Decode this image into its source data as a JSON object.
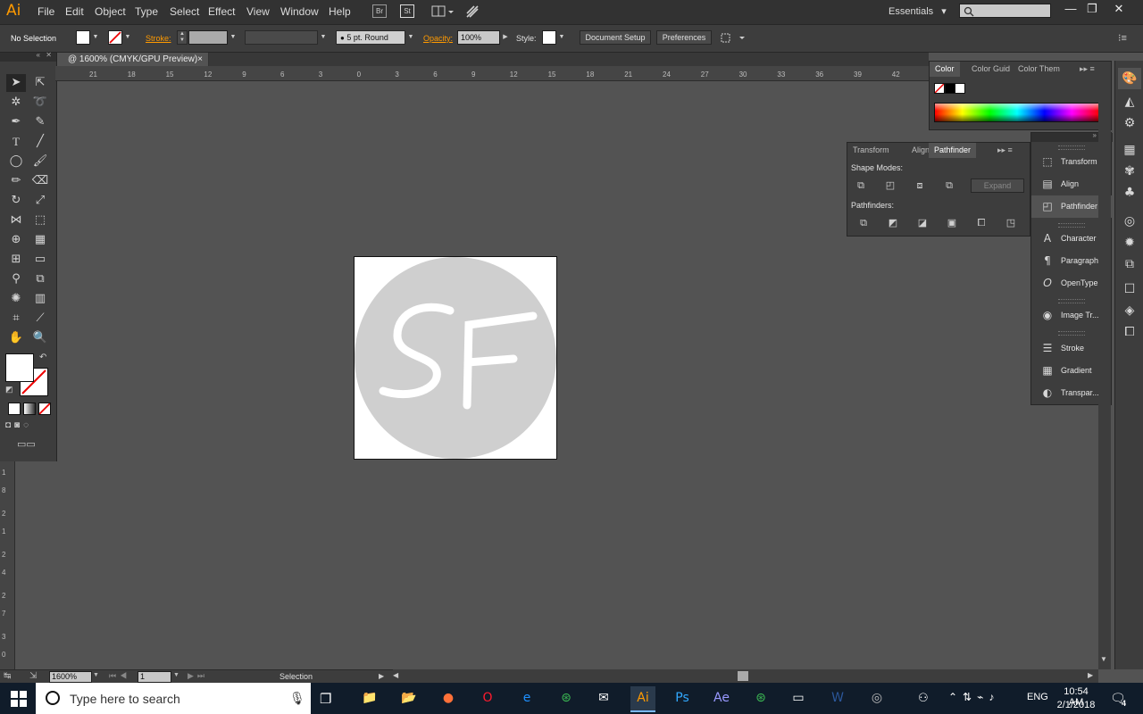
{
  "app": {
    "logo": "Ai"
  },
  "menu": [
    "File",
    "Edit",
    "Object",
    "Type",
    "Select",
    "Effect",
    "View",
    "Window",
    "Help"
  ],
  "menubar_buttons": {
    "bridge": "Br",
    "stock": "St"
  },
  "workspace": {
    "label": "Essentials",
    "arrow": "▾"
  },
  "window_controls": {
    "minimize": "—",
    "restore": "❐",
    "close": "✕"
  },
  "control": {
    "selection": "No Selection",
    "stroke_label": "Stroke:",
    "brush": "5 pt. Round",
    "opacity_label": "Opacity:",
    "opacity_value": "100%",
    "style_label": "Style:",
    "document_setup": "Document Setup",
    "preferences": "Preferences"
  },
  "document_tab": {
    "title": "@ 1600% (CMYK/GPU Preview)",
    "close": "×"
  },
  "ruler_h": [
    "21",
    "18",
    "15",
    "12",
    "9",
    "6",
    "3",
    "0",
    "3",
    "6",
    "9",
    "12",
    "15",
    "18",
    "21",
    "24",
    "27",
    "30",
    "33",
    "36",
    "39",
    "42"
  ],
  "ruler_v": [
    "1",
    "8",
    "2",
    "1",
    "2",
    "4",
    "2",
    "7",
    "3",
    "0"
  ],
  "artwork": {
    "text": "SF",
    "circle_color": "#cfcfcf"
  },
  "color_panel": {
    "tabs": [
      "Color",
      "Color Guid",
      "Color Them"
    ]
  },
  "pathfinder_panel": {
    "tabs": [
      "Transform",
      "Align",
      "Pathfinder"
    ],
    "shape_modes_label": "Shape Modes:",
    "pathfinders_label": "Pathfinders:",
    "expand": "Expand"
  },
  "dock": {
    "group1": [
      "Transform",
      "Align",
      "Pathfinder"
    ],
    "group2": [
      "Character",
      "Paragraph",
      "OpenType"
    ],
    "group3": [
      "Image Tr..."
    ],
    "group4": [
      "Stroke",
      "Gradient",
      "Transpar..."
    ]
  },
  "status": {
    "zoom": "1600%",
    "artboard": "1",
    "tool": "Selection"
  },
  "taskbar": {
    "search_placeholder": "Type here to search",
    "lang": "ENG",
    "time": "10:54 AM",
    "date": "2/1/2018",
    "notif_count": "4",
    "apps": [
      {
        "icon": "file-explorer-icon",
        "label": "📁",
        "color": "#f0c040"
      },
      {
        "icon": "folder-icon",
        "label": "📂",
        "color": "#3e8ed8"
      },
      {
        "icon": "firefox-icon",
        "label": "●",
        "color": "#ff7139"
      },
      {
        "icon": "opera-icon",
        "label": "O",
        "color": "#ff1b2d"
      },
      {
        "icon": "edge-icon",
        "label": "e",
        "color": "#1e90ff"
      },
      {
        "icon": "chrome-like-icon",
        "label": "⊛",
        "color": "#3cba54"
      },
      {
        "icon": "mail-icon",
        "label": "✉",
        "color": "#ffffff"
      },
      {
        "icon": "illustrator-icon",
        "label": "Ai",
        "color": "#ff9a00"
      },
      {
        "icon": "photoshop-icon",
        "label": "Ps",
        "color": "#31a8ff"
      },
      {
        "icon": "after-effects-icon",
        "label": "Ae",
        "color": "#9999ff"
      },
      {
        "icon": "app-green-icon",
        "label": "⊛",
        "color": "#3cba54"
      },
      {
        "icon": "terminal-icon",
        "label": "▭",
        "color": "#ffffff"
      },
      {
        "icon": "word-icon",
        "label": "W",
        "color": "#2b579a"
      },
      {
        "icon": "chat-icon",
        "label": "◎",
        "color": "#bbbbbb"
      }
    ]
  }
}
